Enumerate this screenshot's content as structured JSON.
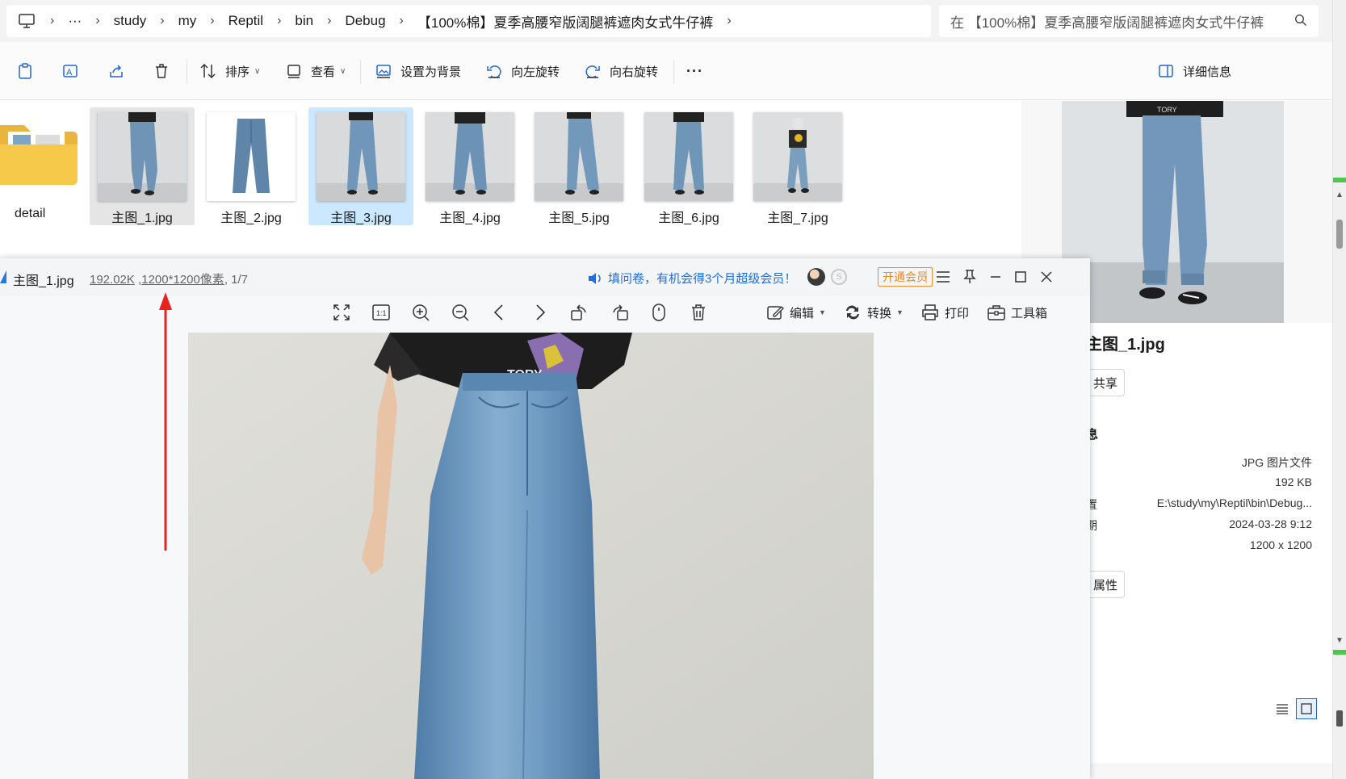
{
  "address": {
    "crumbs": [
      "···",
      "study",
      "my",
      "Reptil",
      "bin",
      "Debug",
      "【100%棉】夏季高腰窄版阔腿裤遮肉女式牛仔裤"
    ],
    "search_placeholder": "在 【100%棉】夏季高腰窄版阔腿裤遮肉女式牛仔裤"
  },
  "toolbar": {
    "sort": "排序",
    "view": "查看",
    "set_background": "设置为背景",
    "rotate_left": "向左旋转",
    "rotate_right": "向右旋转",
    "more": "···",
    "details": "详细信息"
  },
  "files": {
    "folder": "detail",
    "items": [
      "主图_1.jpg",
      "主图_2.jpg",
      "主图_3.jpg",
      "主图_4.jpg",
      "主图_5.jpg",
      "主图_6.jpg",
      "主图_7.jpg"
    ]
  },
  "details_pane": {
    "title": "主图_1.jpg",
    "share_btn": "共享",
    "section": "息",
    "rows": [
      {
        "key": "",
        "value": "JPG 图片文件"
      },
      {
        "key": "",
        "value": "192 KB"
      },
      {
        "key": "置",
        "value": "E:\\study\\my\\Reptil\\bin\\Debug..."
      },
      {
        "key": "期",
        "value": "2024-03-28 9:12"
      },
      {
        "key": "",
        "value": "1200 x 1200"
      }
    ],
    "props_btn": "属性"
  },
  "viewer": {
    "filename": "主图_1.jpg",
    "size": "192.02K",
    "dims": "1200*1200像素",
    "index": "1/7",
    "promo": "填问卷，有机会得3个月超级会员！",
    "vip": "开通会员",
    "edit": "编辑",
    "convert": "转换",
    "print": "打印",
    "toolbox": "工具箱"
  },
  "colors": {
    "accent": "#1e6fe6",
    "vip": "#f08a24",
    "arrow": "#e8231f",
    "selection": "#cce8ff"
  }
}
